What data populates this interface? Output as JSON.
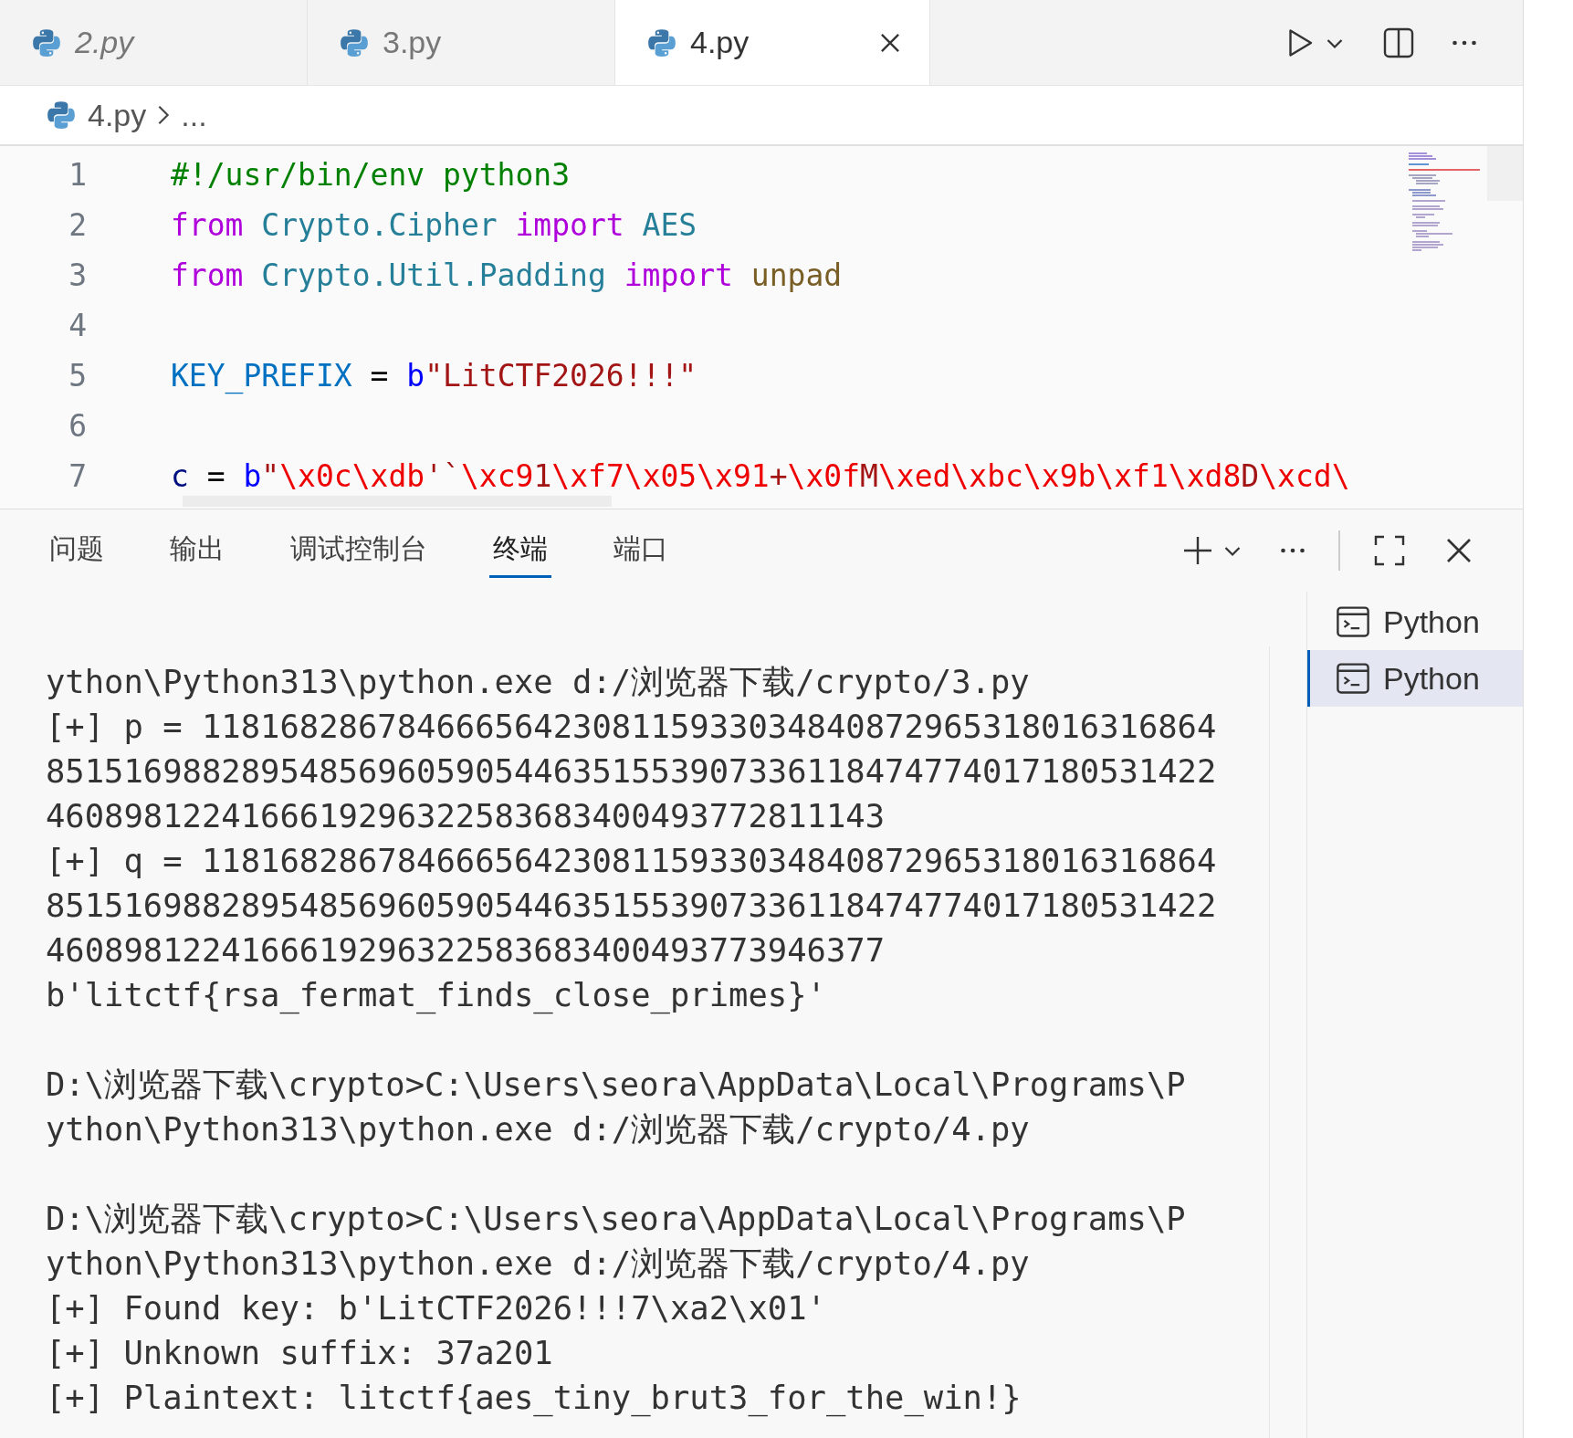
{
  "tabs": [
    {
      "label": "2.py",
      "selected": false,
      "preview": true
    },
    {
      "label": "3.py",
      "selected": false,
      "preview": false
    },
    {
      "label": "4.py",
      "selected": true,
      "preview": false
    }
  ],
  "breadcrumb": {
    "file": "4.py",
    "more": "..."
  },
  "editor": {
    "lines": [
      {
        "number": "1",
        "tokens": [
          {
            "text": "#!/usr/bin/env python3",
            "kind": "comment"
          }
        ]
      },
      {
        "number": "2",
        "tokens": [
          {
            "text": "from ",
            "kind": "keyword"
          },
          {
            "text": "Crypto.Cipher ",
            "kind": "module"
          },
          {
            "text": "import ",
            "kind": "keyword"
          },
          {
            "text": "AES",
            "kind": "module"
          }
        ]
      },
      {
        "number": "3",
        "tokens": [
          {
            "text": "from ",
            "kind": "keyword"
          },
          {
            "text": "Crypto.Util.Padding ",
            "kind": "module"
          },
          {
            "text": "import ",
            "kind": "keyword"
          },
          {
            "text": "unpad",
            "kind": "function"
          }
        ]
      },
      {
        "number": "4"
      },
      {
        "number": "5",
        "tokens": [
          {
            "text": "KEY_PREFIX",
            "kind": "constant"
          },
          {
            "text": " = ",
            "kind": "plain"
          },
          {
            "text": "b",
            "kind": "prefix"
          },
          {
            "text": "\"LitCTF2026!!!\"",
            "kind": "string"
          }
        ]
      },
      {
        "number": "6"
      },
      {
        "number": "7",
        "tokens": [
          {
            "text": "c",
            "kind": "variable"
          },
          {
            "text": " = ",
            "kind": "plain"
          },
          {
            "text": "b",
            "kind": "prefix"
          },
          {
            "text": "\"",
            "kind": "string"
          },
          {
            "text": "\\x0c\\xdb",
            "kind": "escape"
          },
          {
            "text": "'`",
            "kind": "string"
          },
          {
            "text": "\\xc9",
            "kind": "escape"
          },
          {
            "text": "1",
            "kind": "string"
          },
          {
            "text": "\\xf7\\x05\\x91",
            "kind": "escape"
          },
          {
            "text": "+",
            "kind": "string"
          },
          {
            "text": "\\x0f",
            "kind": "escape"
          },
          {
            "text": "M",
            "kind": "string"
          },
          {
            "text": "\\xed\\xbc\\x9b\\xf1\\xd8",
            "kind": "escape"
          },
          {
            "text": "D",
            "kind": "string"
          },
          {
            "text": "\\xcd\\",
            "kind": "escape"
          }
        ]
      }
    ]
  },
  "panel": {
    "tabs": [
      {
        "label": "问题",
        "selected": false
      },
      {
        "label": "输出",
        "selected": false
      },
      {
        "label": "调试控制台",
        "selected": false
      },
      {
        "label": "终端",
        "selected": true
      },
      {
        "label": "端口",
        "selected": false
      }
    ],
    "terminal": {
      "blocks": [
        [
          "ython\\Python313\\python.exe d:/浏览器下载/crypto/3.py",
          "[+] p = 1181682867846665642308115933034840872965318016316864",
          "851516988289548569605905446351553907336118474774017180531422",
          "4608981224166619296322583683400493772811143",
          "[+] q = 1181682867846665642308115933034840872965318016316864",
          "851516988289548569605905446351553907336118474774017180531422",
          "4608981224166619296322583683400493773946377",
          "b'litctf{rsa_fermat_finds_close_primes}'"
        ],
        [
          "D:\\浏览器下载\\crypto>C:\\Users\\seora\\AppData\\Local\\Programs\\P",
          "ython\\Python313\\python.exe d:/浏览器下载/crypto/4.py"
        ],
        [
          "D:\\浏览器下载\\crypto>C:\\Users\\seora\\AppData\\Local\\Programs\\P",
          "ython\\Python313\\python.exe d:/浏览器下载/crypto/4.py",
          "[+] Found key: b'LitCTF2026!!!7\\xa2\\x01'",
          "[+] Unknown suffix: 37a201",
          "[+] Plaintext: litctf{aes_tiny_brut3_for_the_win!}"
        ]
      ]
    },
    "sessions": [
      {
        "label": "Python",
        "selected": false
      },
      {
        "label": "Python",
        "selected": true
      }
    ]
  }
}
